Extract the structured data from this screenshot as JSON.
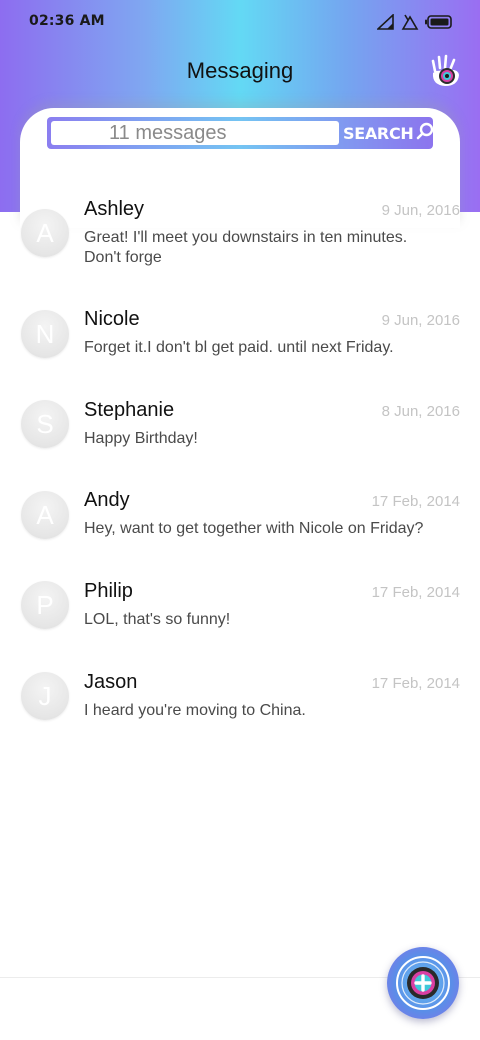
{
  "status_bar": {
    "time": "02:36 AM",
    "icons": [
      "signal-icon",
      "wifi-icon",
      "battery-icon"
    ]
  },
  "header": {
    "title": "Messaging",
    "logo_icon": "hand-eye-logo-icon"
  },
  "search": {
    "placeholder": "11 messages",
    "button_label": "SEARCH",
    "button_icon": "search-icon"
  },
  "conversations": [
    {
      "initial": "A",
      "name": "Ashley",
      "date": "9 Jun, 2016",
      "preview": "Great! I'll meet you downstairs in ten minutes. Don't forge"
    },
    {
      "initial": "N",
      "name": "Nicole",
      "date": "9 Jun, 2016",
      "preview": "Forget it.I don't bl get paid. until next Friday."
    },
    {
      "initial": "S",
      "name": "Stephanie",
      "date": "8 Jun, 2016",
      "preview": "Happy Birthday!"
    },
    {
      "initial": "A",
      "name": "Andy",
      "date": "17 Feb, 2014",
      "preview": "Hey, want to get together with Nicole on Friday?"
    },
    {
      "initial": "P",
      "name": "Philip",
      "date": "17 Feb, 2014",
      "preview": "LOL, that's so funny!"
    },
    {
      "initial": "J",
      "name": "Jason",
      "date": "17 Feb, 2014",
      "preview": "I heard you're moving to China."
    }
  ],
  "fab": {
    "icon": "compose-plus-icon"
  },
  "colors": {
    "header_gradient": [
      "#8d6df0",
      "#63d9f4",
      "#9a6ef2"
    ],
    "date_text": "#c4c4c4",
    "avatar_bg": "#e6e6e6"
  }
}
